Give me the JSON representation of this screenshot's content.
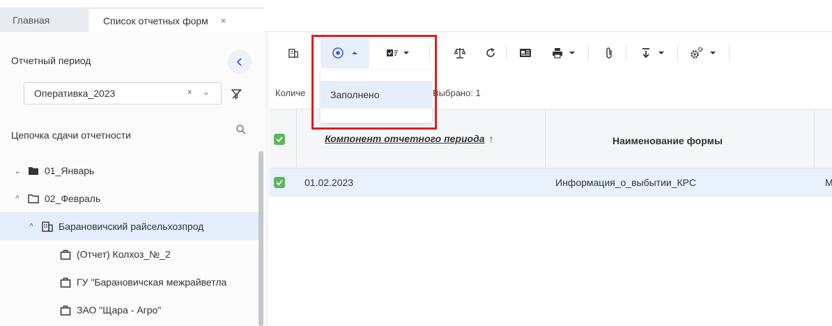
{
  "tabs": {
    "home_label": "Главная",
    "active_label": "Список отчетных форм",
    "close_glyph": "×"
  },
  "sidebar": {
    "period_title": "Отчетный период",
    "collapse_glyph": "‹",
    "period_value": "Оперативка_2023",
    "period_controls": "× ⌄",
    "chain_title": "Цепочка сдачи отчетности",
    "tree": [
      {
        "chevron": "⌄",
        "icon": "folder-filled-icon",
        "label": "01_Январь"
      },
      {
        "chevron": "^",
        "icon": "folder-open-icon",
        "label": "02_Февраль"
      },
      {
        "chevron": "^",
        "icon": "building-icon",
        "label": "Барановичский райсельхозпрод"
      },
      {
        "chevron": "",
        "icon": "briefcase-icon",
        "label": "(Отчет) Колхоз_№_2"
      },
      {
        "chevron": "",
        "icon": "briefcase-icon",
        "label": "ГУ \"Барановичская межрайветла"
      },
      {
        "chevron": "",
        "icon": "briefcase-icon",
        "label": "ЗАО \"Щара - Агро\""
      }
    ]
  },
  "toolbar": {
    "items": [
      "building-icon",
      "status-circle-icon",
      "form-check-icon",
      "scales-icon",
      "refresh-icon",
      "id-card-icon",
      "print-icon",
      "paperclip-icon",
      "download-icon",
      "settings-icon"
    ]
  },
  "dropdown": {
    "item_label": "Заполнено"
  },
  "count": {
    "prefix": "Количе",
    "fragment": "1",
    "selected": "Выбрано: 1"
  },
  "table": {
    "col_component": "Компонент отчетного периода",
    "sort_glyph": "↑",
    "col_form_name": "Наименование формы",
    "rows": [
      {
        "date": "01.02.2023",
        "form_name": "Информация_о_выбытии_КРС",
        "extra": "М"
      }
    ]
  },
  "colors": {
    "accent": "#3b5bdb",
    "checkbox": "#5cb85c",
    "highlight": "#e21b1b",
    "selected_row": "#e3eefc"
  }
}
